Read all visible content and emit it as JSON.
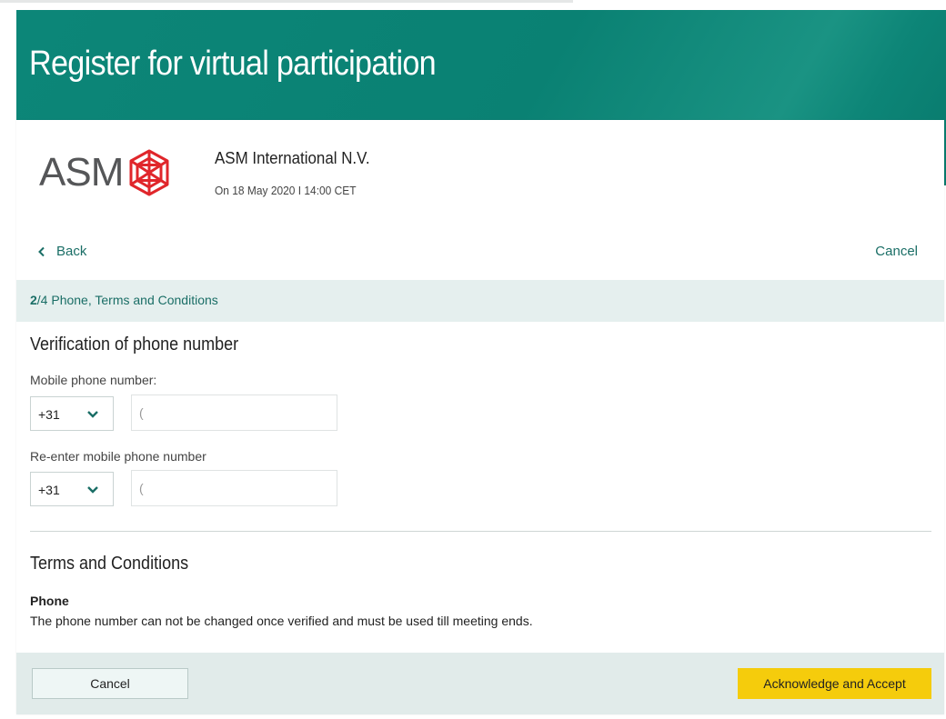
{
  "page": {
    "title": "Register for virtual participation"
  },
  "company": {
    "logo_text": "ASM",
    "name": "ASM International N.V.",
    "meeting_date": "On 18 May 2020 I 14:00 CET"
  },
  "nav": {
    "back_label": "Back",
    "cancel_label": "Cancel"
  },
  "step": {
    "current": "2",
    "rest": "/4 Phone, Terms and Conditions"
  },
  "phone_verification": {
    "title": "Verification of phone number",
    "mobile_label": "Mobile phone number:",
    "country_code": "+31",
    "mobile_value": "(",
    "reenter_label": "Re-enter mobile phone number",
    "reenter_country_code": "+31",
    "reenter_value": "("
  },
  "terms": {
    "title": "Terms and Conditions",
    "phone_heading": "Phone",
    "phone_text": "The phone number can not be changed once verified and must be used till meeting ends."
  },
  "footer": {
    "cancel_label": "Cancel",
    "accept_label": "Acknowledge and Accept"
  },
  "colors": {
    "banner": "#0a8173",
    "accent_text": "#1a6e66",
    "step_bar": "#e5efee",
    "accept_button": "#f5cc0c",
    "logo_red": "#e0262b"
  },
  "icons": {
    "back": "chevron-left-icon",
    "select": "chevron-down-icon",
    "logo": "asm-logo-mark"
  }
}
